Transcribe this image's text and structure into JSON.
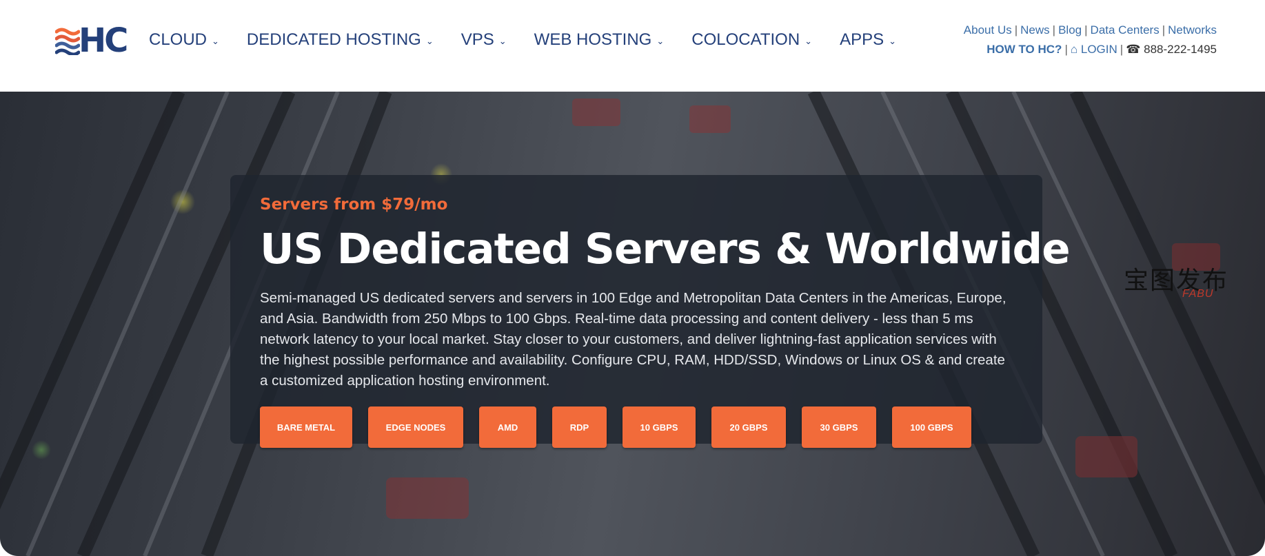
{
  "brand": {
    "logo_text": "HC",
    "accent_color": "#f26b3a",
    "nav_color": "#24407a",
    "link_color": "#3b6ea8"
  },
  "nav": {
    "items": [
      {
        "label": "CLOUD"
      },
      {
        "label": "DEDICATED HOSTING"
      },
      {
        "label": "VPS"
      },
      {
        "label": "WEB HOSTING"
      },
      {
        "label": "COLOCATION"
      },
      {
        "label": "APPS"
      }
    ]
  },
  "top_links": {
    "about": "About Us",
    "news": "News",
    "blog": "Blog",
    "data_centers": "Data Centers",
    "networks": "Networks",
    "how_to": "HOW TO HC?",
    "login": "LOGIN",
    "phone": "888-222-1495",
    "separator": "|",
    "login_icon": "⌂",
    "phone_icon": "☎"
  },
  "hero": {
    "tagline": "Servers from $79/mo",
    "title": "US Dedicated Servers & Worldwide",
    "description": "Semi-managed US dedicated servers and servers in 100 Edge and Metropolitan Data Centers in the Americas, Europe, and Asia. Bandwidth from 250 Mbps to 100 Gbps. Real-time data processing and content delivery - less than 5 ms network latency to your local market. Stay closer to your customers, and deliver lightning-fast application services with the highest possible performance and availability. Configure CPU, RAM, HDD/SSD, Windows or Linux OS & and create a customized application hosting environment.",
    "buttons": [
      {
        "label": "BARE METAL"
      },
      {
        "label": "EDGE NODES"
      },
      {
        "label": "AMD"
      },
      {
        "label": "RDP"
      },
      {
        "label": "10 GBPS"
      },
      {
        "label": "20 GBPS"
      },
      {
        "label": "30 GBPS"
      },
      {
        "label": "100 GBPS"
      }
    ]
  },
  "watermark": {
    "cn": "宝图发布",
    "en": "FABU"
  }
}
